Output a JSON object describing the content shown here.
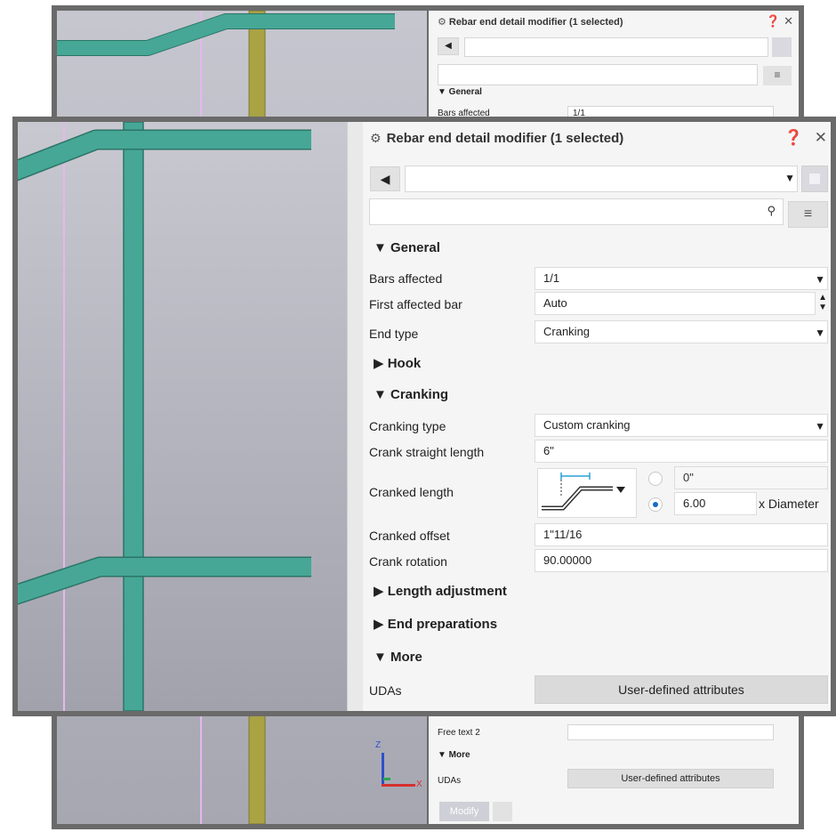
{
  "panel": {
    "title": "Rebar end detail modifier (1 selected)",
    "help_icon": "❓",
    "close_icon": "✕"
  },
  "toolbar": {
    "back_label": "◀",
    "preset_value": "",
    "search_value": "",
    "menu_label": "≡"
  },
  "sections": {
    "general": "▼ General",
    "hook": "▶ Hook",
    "cranking": "▼ Cranking",
    "length_adjustment": "▶ Length adjustment",
    "end_preparations": "▶ End preparations",
    "more": "▼ More"
  },
  "fields": {
    "bars_affected": {
      "label": "Bars affected",
      "value": "1/1"
    },
    "first_affected_bar": {
      "label": "First affected bar",
      "value": "Auto"
    },
    "end_type": {
      "label": "End type",
      "value": "Cranking"
    },
    "cranking_type": {
      "label": "Cranking type",
      "value": "Custom cranking"
    },
    "crank_straight_length": {
      "label": "Crank straight length",
      "value": "6\""
    },
    "cranked_length": {
      "label": "Cranked length",
      "absolute_value": "0\"",
      "factor_value": "6.00",
      "factor_unit": "x Diameter"
    },
    "cranked_offset": {
      "label": "Cranked offset",
      "value": "1\"11/16"
    },
    "crank_rotation": {
      "label": "Crank rotation",
      "value": "90.00000"
    },
    "udas": {
      "label": "UDAs",
      "button": "User-defined attributes"
    }
  },
  "background_panel": {
    "title": "Rebar end detail modifier (1 selected)",
    "general": "▼ General",
    "bars_affected_label": "Bars affected",
    "bars_affected_value": "1/1",
    "free_text_2": "Free text 2",
    "more": "▼ More",
    "udas_label": "UDAs",
    "udas_button": "User-defined attributes",
    "modify_button": "Modify"
  },
  "axes": {
    "z": "Z",
    "x": "X"
  },
  "colors": {
    "rebar_teal": "#46a796",
    "rebar_outline": "#2c7466",
    "column_olive": "#a9a344",
    "guide_line": "#e4b8ee",
    "radio_selected": "#1a6ac7"
  }
}
